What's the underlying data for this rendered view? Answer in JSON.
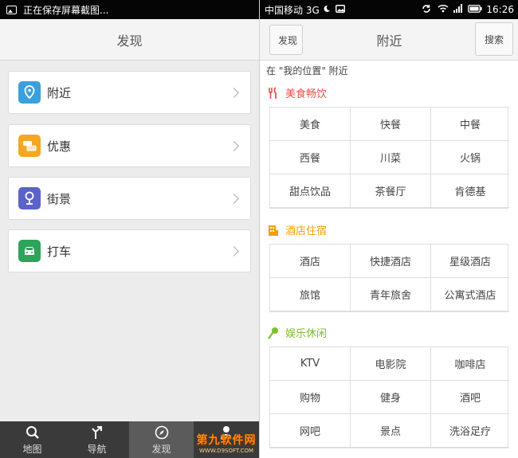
{
  "left": {
    "status_text": "正在保存屏幕截图...",
    "header_title": "发现",
    "menu": [
      {
        "label": "附近",
        "icon": "location-pin-icon",
        "color": "#3b9fdc"
      },
      {
        "label": "优惠",
        "icon": "coupon-icon",
        "color": "#f5a623"
      },
      {
        "label": "街景",
        "icon": "street-view-icon",
        "color": "#5b63c9"
      },
      {
        "label": "打车",
        "icon": "taxi-icon",
        "color": "#2ea45a"
      }
    ],
    "bottom_nav": [
      {
        "label": "地图",
        "icon": "search-icon"
      },
      {
        "label": "导航",
        "icon": "navigation-icon"
      },
      {
        "label": "发现",
        "icon": "compass-icon",
        "active": true
      },
      {
        "label": "",
        "icon": "user-icon"
      }
    ],
    "watermark": {
      "brand": "第九软件网",
      "url": "WWW.D9SOFT.COM"
    }
  },
  "right": {
    "status": {
      "carrier": "中国移动 3G",
      "time": "16:26"
    },
    "header": {
      "back_label": "发现",
      "title": "附近",
      "search_label": "搜索"
    },
    "location_line": "在 \"我的位置\" 附近",
    "sections": [
      {
        "title": "美食畅饮",
        "icon": "fork-knife-icon",
        "color": "#e8524a",
        "items": [
          "美食",
          "快餐",
          "中餐",
          "西餐",
          "川菜",
          "火锅",
          "甜点饮品",
          "茶餐厅",
          "肯德基"
        ]
      },
      {
        "title": "酒店住宿",
        "icon": "hotel-icon",
        "color": "#f0a000",
        "items": [
          "酒店",
          "快捷酒店",
          "星级酒店",
          "旅馆",
          "青年旅舍",
          "公寓式酒店"
        ]
      },
      {
        "title": "娱乐休闲",
        "icon": "microphone-icon",
        "color": "#7bbf2a",
        "items": [
          "KTV",
          "电影院",
          "咖啡店",
          "购物",
          "健身",
          "酒吧",
          "网吧",
          "景点",
          "洗浴足疗"
        ]
      }
    ]
  }
}
